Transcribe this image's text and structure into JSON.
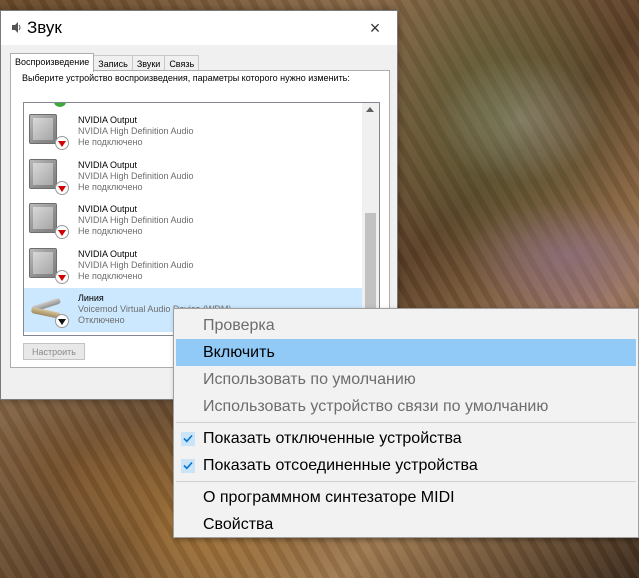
{
  "window": {
    "title": "Звук",
    "close_glyph": "×"
  },
  "tabs": [
    {
      "label": "Воспроизведение",
      "active": true
    },
    {
      "label": "Запись",
      "active": false
    },
    {
      "label": "Звуки",
      "active": false
    },
    {
      "label": "Связь",
      "active": false
    }
  ],
  "instructions": "Выберите устройство воспроизведения, параметры которого нужно изменить:",
  "devices": [
    {
      "name": "NVIDIA Output",
      "driver": "NVIDIA High Definition Audio",
      "status": "Не подключено",
      "icon": "speaker-icon",
      "status_icon": "red-down-arrow-icon"
    },
    {
      "name": "NVIDIA Output",
      "driver": "NVIDIA High Definition Audio",
      "status": "Не подключено",
      "icon": "speaker-icon",
      "status_icon": "red-down-arrow-icon"
    },
    {
      "name": "NVIDIA Output",
      "driver": "NVIDIA High Definition Audio",
      "status": "Не подключено",
      "icon": "speaker-icon",
      "status_icon": "red-down-arrow-icon"
    },
    {
      "name": "NVIDIA Output",
      "driver": "NVIDIA High Definition Audio",
      "status": "Не подключено",
      "icon": "speaker-icon",
      "status_icon": "red-down-arrow-icon"
    },
    {
      "name": "Линия",
      "driver": "Voicemod Virtual Audio Device (WDM)",
      "status": "Отключено",
      "icon": "line-in-icon",
      "status_icon": "black-down-arrow-icon",
      "selected": true
    }
  ],
  "buttons": {
    "configure": "Настроить"
  },
  "context_menu": {
    "items": [
      {
        "label": "Проверка",
        "disabled": true,
        "checked": false
      },
      {
        "label": "Включить",
        "disabled": false,
        "checked": false,
        "highlighted": true
      },
      {
        "label": "Использовать по умолчанию",
        "disabled": true,
        "checked": false
      },
      {
        "label": "Использовать устройство связи по умолчанию",
        "disabled": true,
        "checked": false
      },
      {
        "label": "Показать отключенные устройства",
        "disabled": false,
        "checked": true
      },
      {
        "label": "Показать отсоединенные устройства",
        "disabled": false,
        "checked": true
      },
      {
        "label": "О программном синтезаторе MIDI",
        "disabled": false,
        "checked": false
      },
      {
        "label": "Свойства",
        "disabled": false,
        "checked": false
      }
    ]
  },
  "colors": {
    "selection": "#cce8ff",
    "menu_highlight": "#91c9f7",
    "check_mark": "#0078d7",
    "error_arrow": "#d40000"
  }
}
